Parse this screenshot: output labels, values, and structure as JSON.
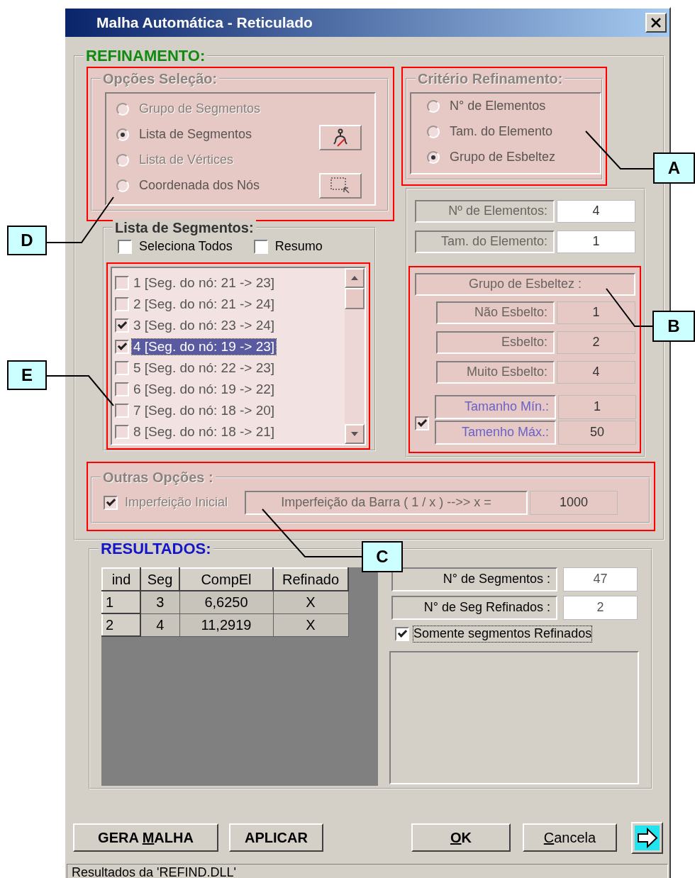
{
  "window": {
    "title": "Malha Automática - Reticulado"
  },
  "refinement": {
    "title": "REFINAMENTO:",
    "selection_options": {
      "title": "Opções Seleção:",
      "options": [
        {
          "label": "Grupo de Segmentos",
          "selected": false,
          "disabled": true
        },
        {
          "label": "Lista de Segmentos",
          "selected": true,
          "disabled": false
        },
        {
          "label": "Lista de Vértices",
          "selected": false,
          "disabled": true
        },
        {
          "label": "Coordenada dos Nós",
          "selected": false,
          "disabled": false
        }
      ]
    },
    "segment_list": {
      "title": "Lista de Segmentos:",
      "select_all": {
        "label": "Seleciona Todos",
        "checked": false
      },
      "summary": {
        "label": "Resumo",
        "checked": false
      },
      "items": [
        {
          "label": "1 [Seg. do nó: 21 -> 23]",
          "checked": false,
          "selected": false
        },
        {
          "label": "2 [Seg. do nó: 21 -> 24]",
          "checked": false,
          "selected": false
        },
        {
          "label": "3 [Seg. do nó: 23 -> 24]",
          "checked": true,
          "selected": false
        },
        {
          "label": "4 [Seg. do nó: 19 -> 23]",
          "checked": true,
          "selected": true
        },
        {
          "label": "5 [Seg. do nó: 22 -> 23]",
          "checked": false,
          "selected": false
        },
        {
          "label": "6 [Seg. do nó: 19 -> 22]",
          "checked": false,
          "selected": false
        },
        {
          "label": "7 [Seg. do nó: 18 -> 20]",
          "checked": false,
          "selected": false
        },
        {
          "label": "8 [Seg. do nó: 18 -> 21]",
          "checked": false,
          "selected": false
        }
      ]
    },
    "criteria": {
      "title": "Critério Refinamento:",
      "options": [
        {
          "label": "N° de Elementos",
          "selected": false
        },
        {
          "label": "Tam. do Elemento",
          "selected": false
        },
        {
          "label": "Grupo de Esbeltez",
          "selected": true
        }
      ]
    },
    "element_fields": [
      {
        "label": "Nº de Elementos:",
        "value": "4"
      },
      {
        "label": "Tam. do Elemento:",
        "value": "1"
      }
    ],
    "slenderness": {
      "title": "Grupo de Esbeltez :",
      "fields": [
        {
          "label": "Não Esbelto:",
          "value": "1"
        },
        {
          "label": "Esbelto:",
          "value": "2"
        },
        {
          "label": "Muito Esbelto:",
          "value": "4"
        }
      ],
      "size_limits": {
        "checked": true,
        "fields": [
          {
            "label": "Tamanho Mín.:",
            "value": "1"
          },
          {
            "label": "Tamenho Máx.:",
            "value": "50"
          }
        ]
      }
    },
    "other_options": {
      "title": "Outras Opções :",
      "initial_imperfection": {
        "label": "Imperfeição Inicial",
        "checked": true
      },
      "bar_imperfection": {
        "label": "Imperfeição da Barra ( 1 / x ) -->>  x =",
        "value": "1000"
      }
    }
  },
  "results": {
    "title": "RESULTADOS:",
    "table": {
      "columns": [
        "ind",
        "Seg",
        "CompEl",
        "Refinado"
      ],
      "rows": [
        [
          "1",
          "3",
          "6,6250",
          "X"
        ],
        [
          "2",
          "4",
          "11,2919",
          "X"
        ]
      ]
    },
    "counts": [
      {
        "label": "N° de Segmentos :",
        "value": "47"
      },
      {
        "label": "N° de Seg Refinados :",
        "value": "2"
      }
    ],
    "only_refined": {
      "label": "Somente segmentos Refinados",
      "checked": true
    }
  },
  "buttons": [
    {
      "parts": [
        {
          "text": "GERA ",
          "underline": false
        },
        {
          "text": "M",
          "underline": true
        },
        {
          "text": "ALHA",
          "underline": false
        }
      ],
      "bold": true
    },
    {
      "parts": [
        {
          "text": "APLICAR",
          "underline": false
        }
      ],
      "bold": true
    },
    {
      "parts": [
        {
          "text": "O",
          "underline": true
        },
        {
          "text": "K",
          "underline": false
        }
      ],
      "bold": true
    },
    {
      "parts": [
        {
          "text": "C",
          "underline": true
        },
        {
          "text": "ancela",
          "underline": false
        }
      ],
      "bold": false
    }
  ],
  "status_bar": "Resultados da 'REFIND.DLL'",
  "callouts": [
    {
      "label": "A"
    },
    {
      "label": "B"
    },
    {
      "label": "C"
    },
    {
      "label": "D"
    },
    {
      "label": "E"
    }
  ]
}
